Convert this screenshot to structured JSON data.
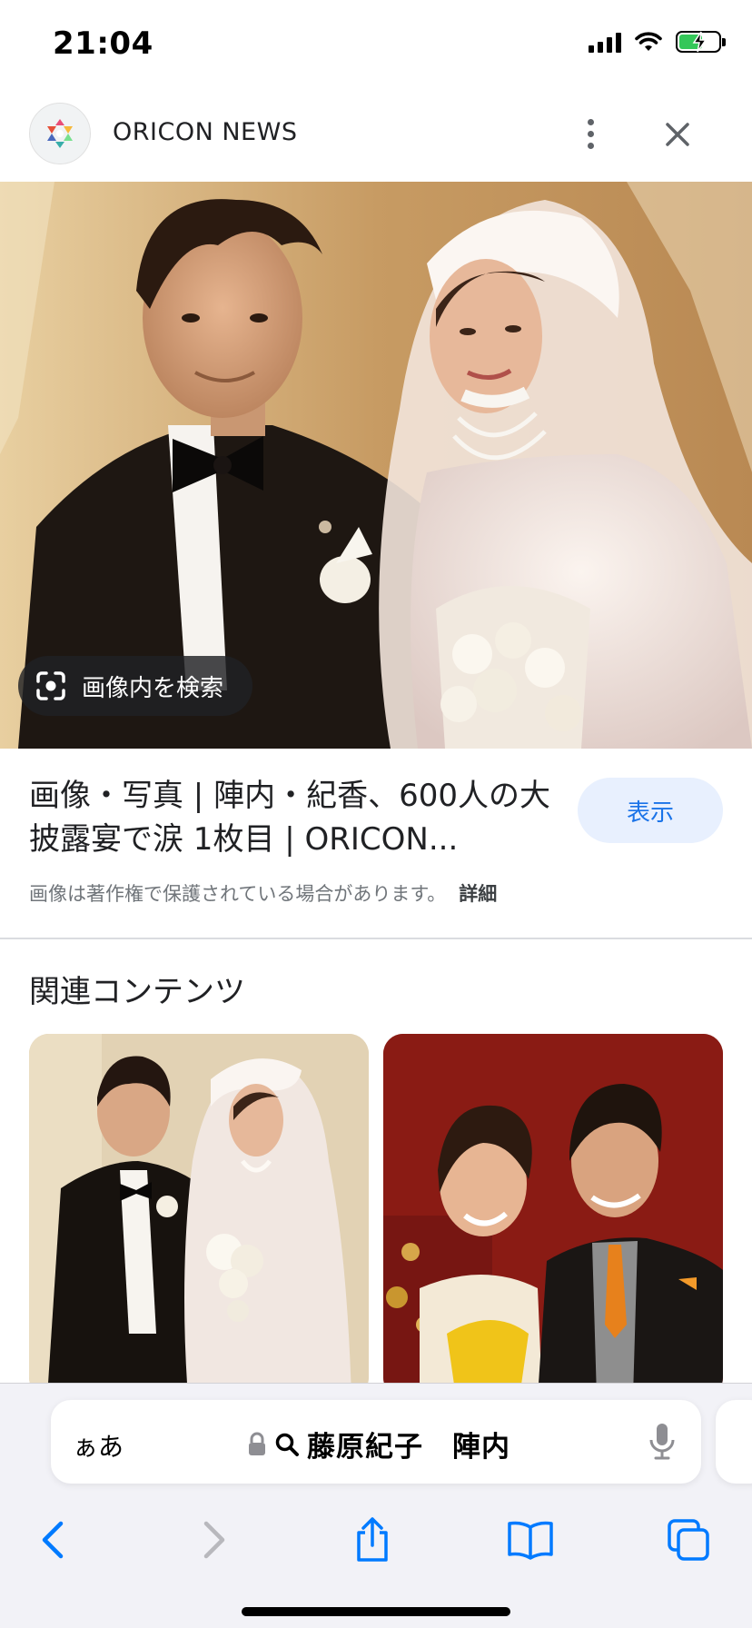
{
  "status_bar": {
    "time": "21:04",
    "battery_level": 0.6,
    "battery_color": "#34c759"
  },
  "header": {
    "site_name": "ORICON NEWS"
  },
  "main_image": {
    "lens_label": "画像内を検索"
  },
  "result": {
    "title": "画像・写真 | 陣内・紀香、600人の大披露宴で涙 1枚目 | ORICON...",
    "view_label": "表示",
    "copyright_notice": "画像は著作権で保護されている場合があります。",
    "details_label": "詳細"
  },
  "related": {
    "heading": "関連コンテンツ"
  },
  "browser": {
    "text_size_label": "ぁあ",
    "url_text": "藤原紀子　陣内"
  },
  "colors": {
    "accent": "#1a73e8",
    "chip_bg": "#e8f0fe",
    "toolbar_icon": "#007aff"
  }
}
